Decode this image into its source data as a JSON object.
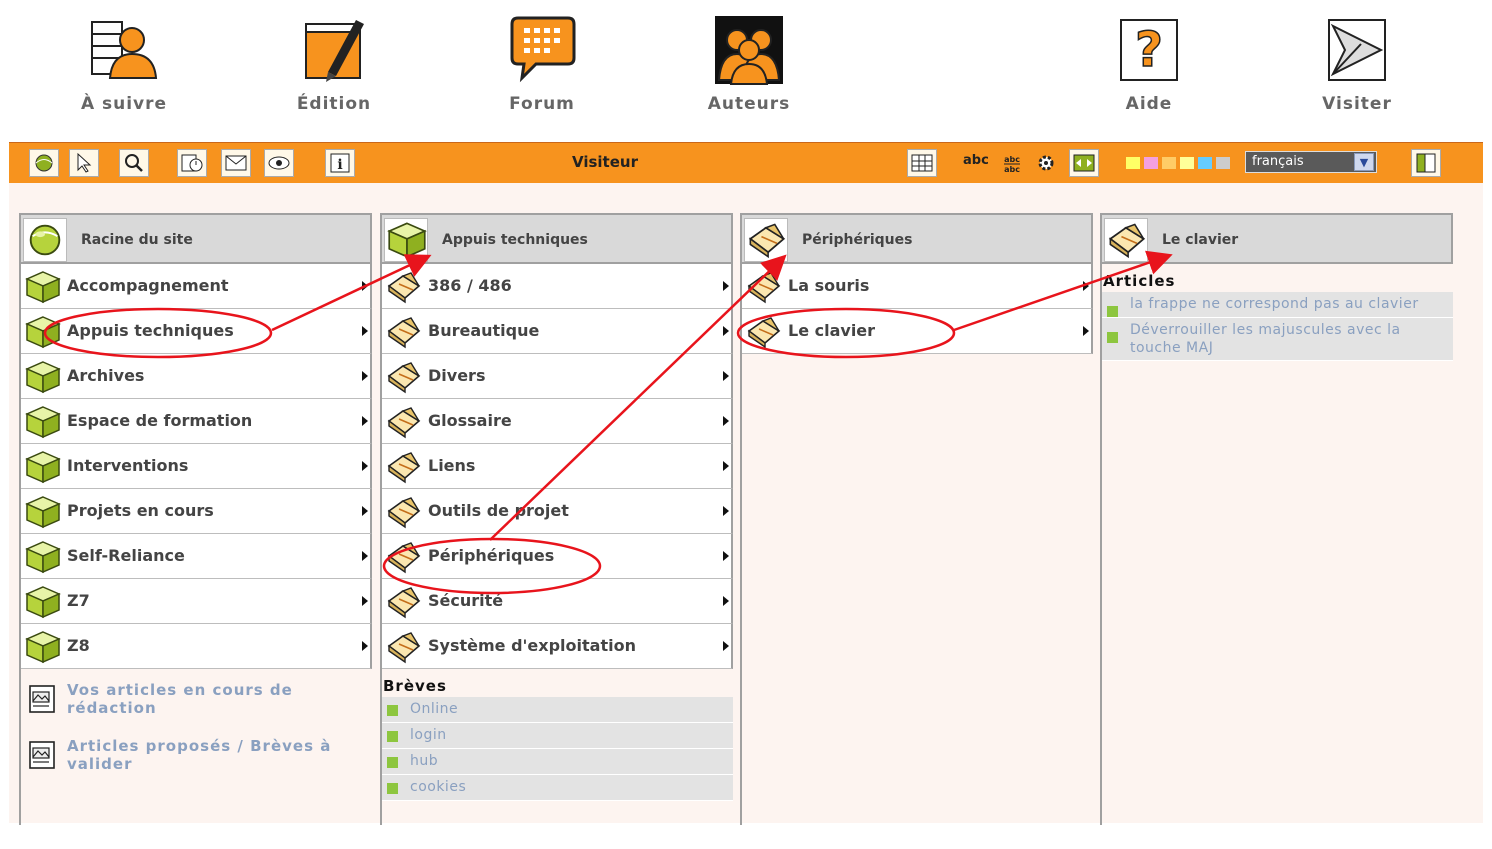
{
  "topnav": {
    "items": [
      {
        "label": "À suivre",
        "icon": "follow-icon"
      },
      {
        "label": "Édition",
        "icon": "edit-icon"
      },
      {
        "label": "Forum",
        "icon": "forum-icon"
      },
      {
        "label": "Auteurs",
        "icon": "authors-icon"
      },
      {
        "label": "Aide",
        "icon": "help-icon"
      },
      {
        "label": "Visiter",
        "icon": "visit-icon"
      }
    ]
  },
  "toolbar": {
    "title": "Visiteur",
    "abc": "abc",
    "language": "français",
    "swatches": [
      "#ffff66",
      "#f4a0e0",
      "#ffcc66",
      "#ffff99",
      "#66ccff",
      "#cccccc"
    ],
    "accent": "#f7931e"
  },
  "columns": [
    {
      "title": "Racine du site",
      "items": [
        "Accompagnement",
        "Appuis techniques",
        "Archives",
        "Espace de formation",
        "Interventions",
        "Projets en cours",
        "Self-Reliance",
        "Z7",
        "Z8"
      ],
      "links": [
        "Vos articles en cours de rédaction",
        "Articles proposés / Brèves à valider"
      ]
    },
    {
      "title": "Appuis techniques",
      "items": [
        "386 / 486",
        "Bureautique",
        "Divers",
        "Glossaire",
        "Liens",
        "Outils de projet",
        "Périphériques",
        "Sécurité",
        "Système d'exploitation"
      ],
      "section_title": "Brèves",
      "section_items": [
        "Online",
        "login",
        "hub",
        "cookies"
      ]
    },
    {
      "title": "Périphériques",
      "items": [
        "La souris",
        "Le clavier"
      ]
    },
    {
      "title": "Le clavier",
      "section_title": "Articles",
      "section_items": [
        "la frappe ne correspond pas au clavier",
        "Déverrouiller les majuscules avec la touche MAJ"
      ]
    }
  ],
  "annotation_color": "#e8141c"
}
